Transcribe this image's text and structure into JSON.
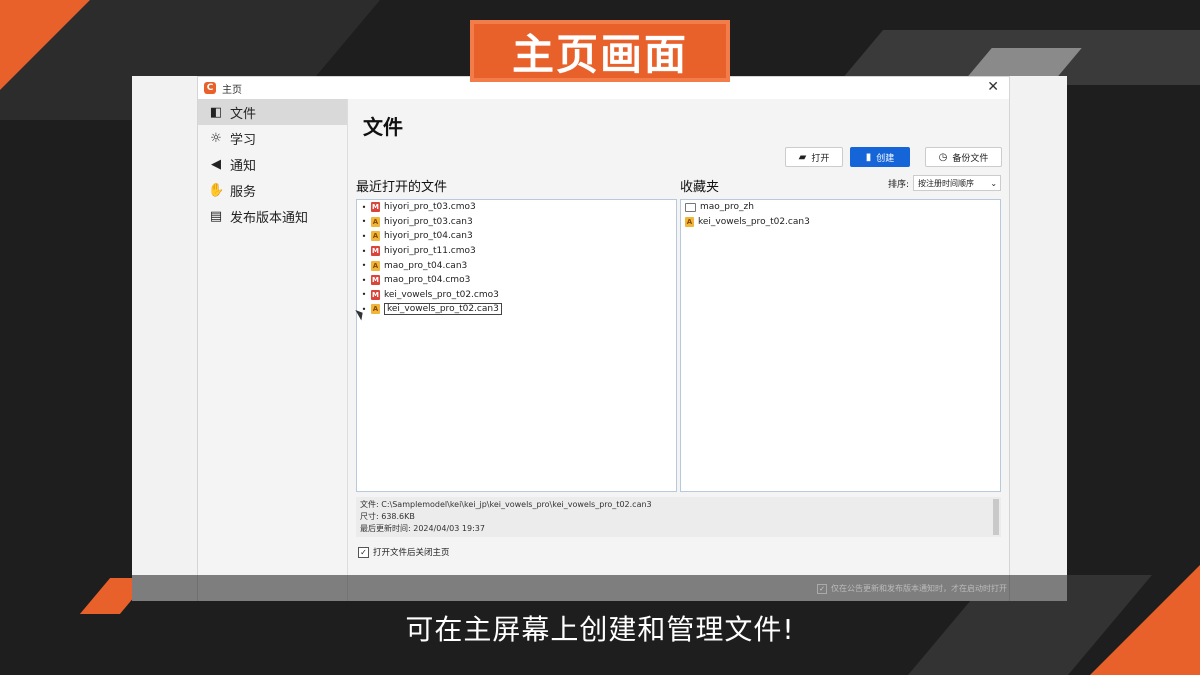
{
  "banner": {
    "title": "主页画面"
  },
  "window": {
    "title": "主页",
    "close_glyph": "✕"
  },
  "sidebar": {
    "items": [
      {
        "label": "文件",
        "icon": "file-icon",
        "glyph": "◧"
      },
      {
        "label": "学习",
        "icon": "lightbulb-icon",
        "glyph": "☼"
      },
      {
        "label": "通知",
        "icon": "megaphone-icon",
        "glyph": "◀"
      },
      {
        "label": "服务",
        "icon": "hand-service-icon",
        "glyph": "✋"
      },
      {
        "label": "发布版本通知",
        "icon": "newspaper-icon",
        "glyph": "▤"
      }
    ]
  },
  "main": {
    "title": "文件",
    "buttons": {
      "open": "打开",
      "create": "创建",
      "backup": "备份文件"
    },
    "recent_label": "最近打开的文件",
    "favorites_label": "收藏夹",
    "sort_label": "排序:",
    "sort_value": "按注册时间顺序",
    "recent_files": [
      {
        "name": "hiyori_pro_t03.cmo3",
        "type": "cmo"
      },
      {
        "name": "hiyori_pro_t03.can3",
        "type": "can"
      },
      {
        "name": "hiyori_pro_t04.can3",
        "type": "can"
      },
      {
        "name": "hiyori_pro_t11.cmo3",
        "type": "cmo"
      },
      {
        "name": "mao_pro_t04.can3",
        "type": "can"
      },
      {
        "name": "mao_pro_t04.cmo3",
        "type": "cmo"
      },
      {
        "name": "kei_vowels_pro_t02.cmo3",
        "type": "cmo"
      },
      {
        "name": "kei_vowels_pro_t02.can3",
        "type": "can"
      }
    ],
    "favorites": [
      {
        "name": "mao_pro_zh",
        "type": "folder"
      },
      {
        "name": "kei_vowels_pro_t02.can3",
        "type": "can"
      }
    ],
    "info": {
      "file": "文件: C:\\Samplemodel\\kei\\kei_jp\\kei_vowels_pro\\kei_vowels_pro_t02.can3",
      "size": "尺寸: 638.6KB",
      "updated": "最后更新时间: 2024/04/03 19:37"
    },
    "close_on_open_label": "打开文件后关闭主页"
  },
  "footer_note": "仅在公告更新和发布版本通知时，才在启动时打开",
  "subtitle": "可在主屏幕上创建和管理文件!"
}
